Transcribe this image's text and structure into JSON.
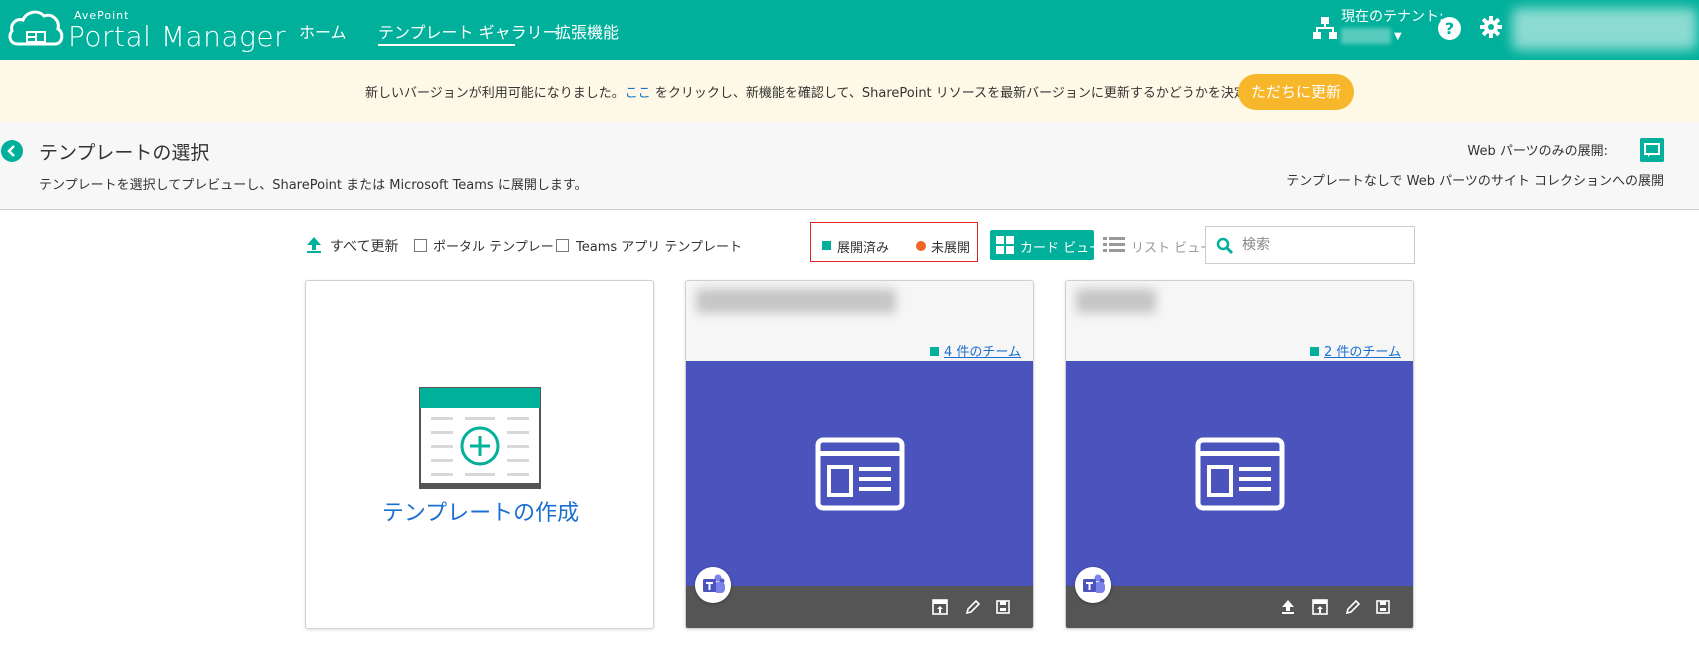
{
  "header": {
    "logo_brand": "AvePoint",
    "logo_title": "Portal Manager",
    "nav": {
      "home": "ホーム",
      "gallery": "テンプレート ギャラリー",
      "extensions": "拡張機能"
    },
    "tenant_label": "現在のテナント:",
    "help_glyph": "?",
    "colors": {
      "bar": "#00b09b"
    }
  },
  "banner": {
    "text_before": "新しいバージョンが利用可能になりました。",
    "link": "ここ",
    "text_after": " をクリックし、新機能を確認して、SharePoint リソースを最新バージョンに更新するかどうかを決定してください。",
    "button": "ただちに更新",
    "colors": {
      "background": "#fef9e6",
      "button": "#f8b62b"
    }
  },
  "page": {
    "title": "テンプレートの選択",
    "subtitle": "テンプレートを選択してプレビューし、SharePoint または Microsoft Teams に展開します。",
    "webparts_label": "Web パーツのみの展開:",
    "webparts_desc": "テンプレートなしで Web パーツのサイト コレクションへの展開"
  },
  "toolbar": {
    "update_all": "すべて更新",
    "filter_portal": "ポータル テンプレート",
    "filter_teams": "Teams アプリ テンプレート",
    "legend_deployed": "展開済み",
    "legend_undeployed": "未展開",
    "card_view": "カード ビュー",
    "list_view": "リスト ビュー",
    "search_placeholder": "検索",
    "colors": {
      "deployed": "#00b09b",
      "undeployed": "#f26522",
      "legend_border": "#e02424"
    }
  },
  "cards": {
    "create_label": "テンプレートの作成",
    "items": [
      {
        "teams_link": "4 件のチーム",
        "type": "teams-app"
      },
      {
        "teams_link": "2 件のチーム",
        "type": "teams-app"
      }
    ],
    "colors": {
      "body": "#4b53bc",
      "footer": "#555555"
    }
  }
}
